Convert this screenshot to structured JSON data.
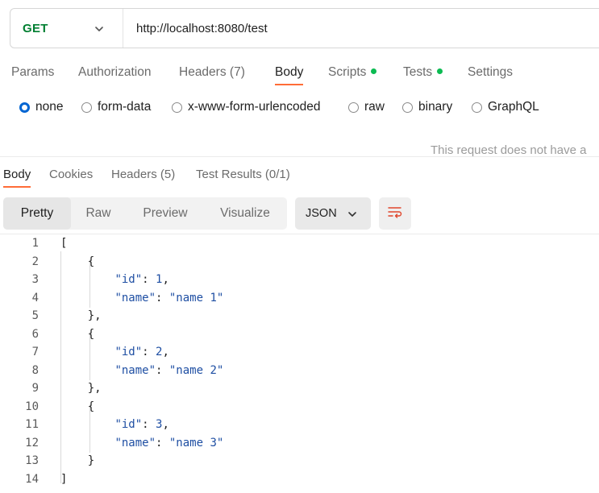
{
  "request": {
    "method": "GET",
    "url": "http://localhost:8080/test"
  },
  "request_tabs": [
    {
      "label": "Params"
    },
    {
      "label": "Authorization"
    },
    {
      "label": "Headers",
      "count": "(7)"
    },
    {
      "label": "Body"
    },
    {
      "label": "Scripts"
    },
    {
      "label": "Tests"
    },
    {
      "label": "Settings"
    }
  ],
  "body_types": [
    "none",
    "form-data",
    "x-www-form-urlencoded",
    "raw",
    "binary",
    "GraphQL"
  ],
  "body_notice": "This request does not have a",
  "response_tabs": [
    {
      "label": "Body"
    },
    {
      "label": "Cookies"
    },
    {
      "label": "Headers",
      "count": "(5)"
    },
    {
      "label": "Test Results",
      "count": "(0/1)"
    }
  ],
  "view_modes": [
    "Pretty",
    "Raw",
    "Preview",
    "Visualize"
  ],
  "format": "JSON",
  "colors": {
    "method": "#007f31",
    "active_tab_underline": "#ff6c37",
    "tab_dot": "#0cbb52",
    "radio_checked": "#0265d2",
    "wrap_icon": "#e0452b"
  },
  "icons": [
    "chevron-down-icon",
    "wrap-lines-icon"
  ],
  "code": {
    "line_numbers": [
      "1",
      "2",
      "3",
      "4",
      "5",
      "6",
      "7",
      "8",
      "9",
      "10",
      "11",
      "12",
      "13",
      "14"
    ],
    "lines": [
      "[",
      "    {",
      "        \"id\": 1,",
      "        \"name\": \"name 1\"",
      "    },",
      "    {",
      "        \"id\": 2,",
      "        \"name\": \"name 2\"",
      "    },",
      "    {",
      "        \"id\": 3,",
      "        \"name\": \"name 3\"",
      "    }",
      "]"
    ]
  }
}
